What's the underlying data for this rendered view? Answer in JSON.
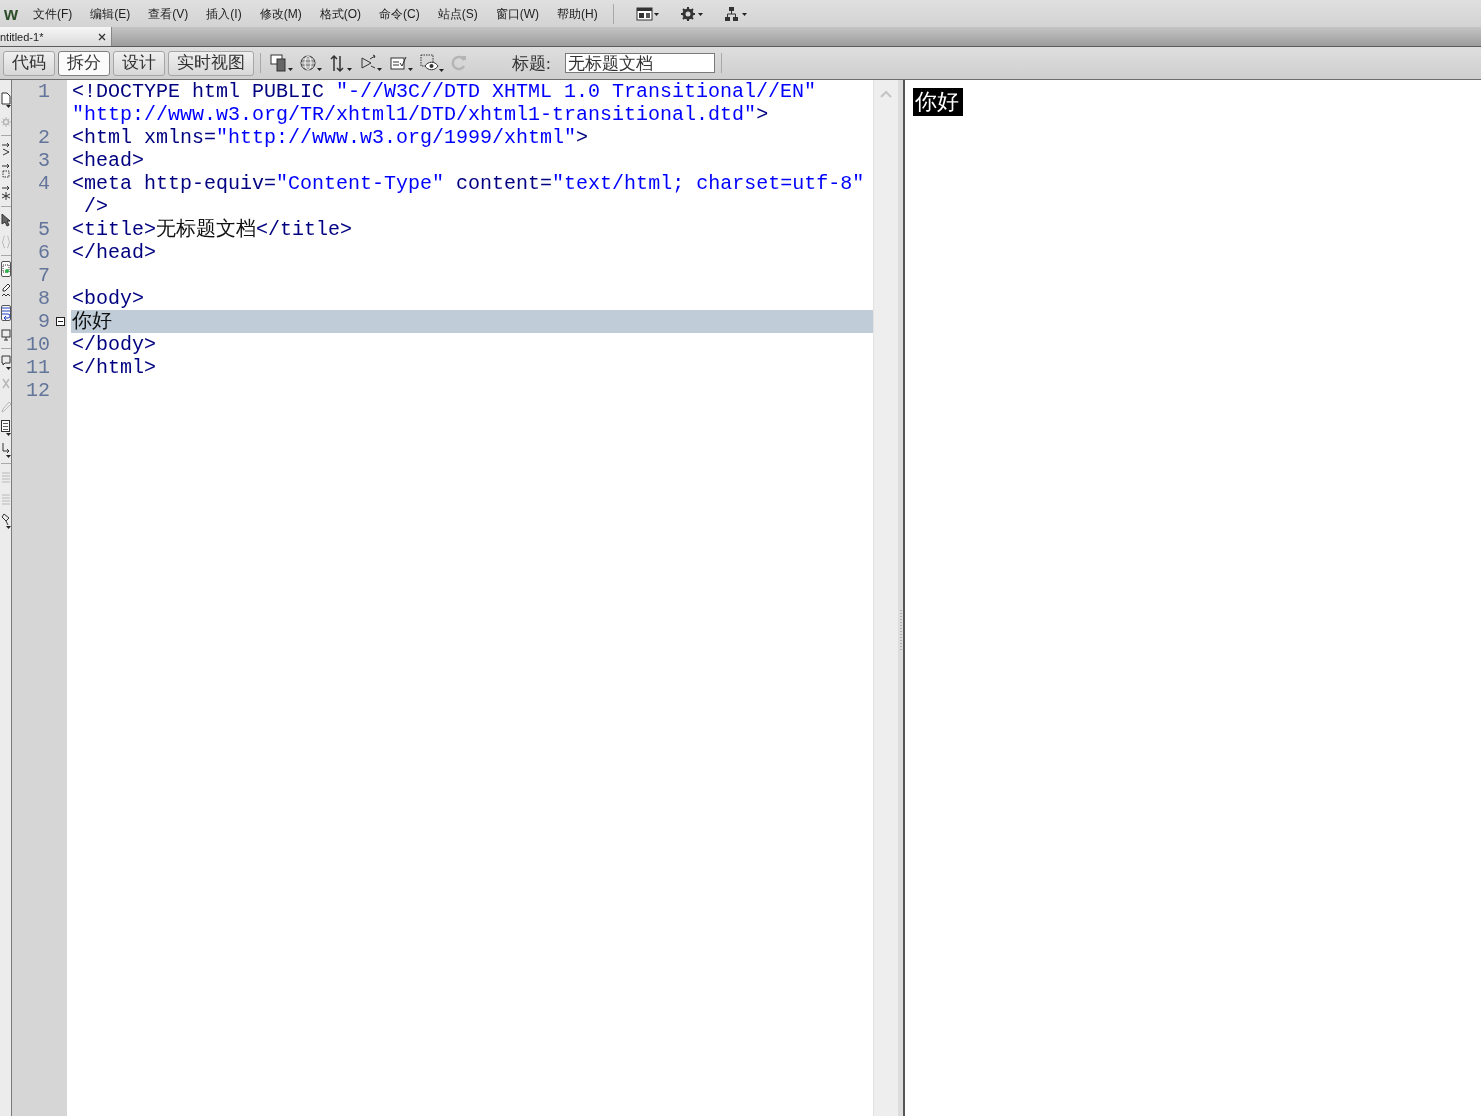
{
  "menu_bar": {
    "logo": "w",
    "items": [
      "文件(F)",
      "编辑(E)",
      "查看(V)",
      "插入(I)",
      "修改(M)",
      "格式(O)",
      "命令(C)",
      "站点(S)",
      "窗口(W)",
      "帮助(H)"
    ]
  },
  "document_tabs": [
    {
      "label": "ntitled-1*",
      "selected": true
    }
  ],
  "view_modes": [
    {
      "label": "代码",
      "selected": false
    },
    {
      "label": "拆分",
      "selected": true
    },
    {
      "label": "设计",
      "selected": false
    },
    {
      "label": "实时视图",
      "selected": false
    }
  ],
  "view_tools": [
    {
      "disabled": false
    },
    {
      "disabled": false
    },
    {
      "disabled": false
    },
    {
      "disabled": false
    },
    {
      "disabled": false
    },
    {
      "disabled": false
    },
    {
      "disabled": true
    }
  ],
  "title_field": {
    "label": "标题:",
    "value": "无标题文档"
  },
  "coding_toolbar": {
    "groups": [
      {
        "tools": [
          {
            "on": false,
            "disabled": false
          },
          {
            "on": false,
            "disabled": true
          }
        ]
      },
      {
        "tools": [
          {
            "on": false,
            "disabled": false
          },
          {
            "on": false,
            "disabled": false
          },
          {
            "on": false,
            "disabled": false
          }
        ]
      },
      {
        "tools": [
          {
            "on": false,
            "disabled": false
          },
          {
            "on": false,
            "disabled": true
          }
        ]
      },
      {
        "tools": [
          {
            "on": true,
            "disabled": false
          },
          {
            "on": false,
            "disabled": false
          },
          {
            "on": true,
            "disabled": false
          },
          {
            "on": false,
            "disabled": false
          }
        ]
      },
      {
        "tools": [
          {
            "on": false,
            "disabled": false
          },
          {
            "on": false,
            "disabled": true
          },
          {
            "on": false,
            "disabled": true
          },
          {
            "on": false,
            "disabled": false
          },
          {
            "on": false,
            "disabled": false
          }
        ]
      },
      {
        "tools": [
          {
            "on": false,
            "disabled": true
          },
          {
            "on": false,
            "disabled": true
          },
          {
            "on": false,
            "disabled": false
          }
        ]
      }
    ]
  },
  "code_editor": {
    "lines": [
      {
        "number": "1",
        "selected": false,
        "fold_marker": false,
        "rows": [
          [
            {
              "kind": "tag",
              "text": "<!DOCTYPE html PUBLIC "
            },
            {
              "kind": "string",
              "text": "\"-//W3C//DTD XHTML 1.0 Transitional//EN\""
            }
          ],
          [
            {
              "kind": "string",
              "text": "\"http://www.w3.org/TR/xhtml1/DTD/xhtml1-transitional.dtd\""
            },
            {
              "kind": "tag",
              "text": ">"
            }
          ]
        ]
      },
      {
        "number": "2",
        "selected": false,
        "fold_marker": false,
        "rows": [
          [
            {
              "kind": "tag",
              "text": "<html xmlns="
            },
            {
              "kind": "string",
              "text": "\"http://www.w3.org/1999/xhtml\""
            },
            {
              "kind": "tag",
              "text": ">"
            }
          ]
        ]
      },
      {
        "number": "3",
        "selected": false,
        "fold_marker": false,
        "rows": [
          [
            {
              "kind": "tag",
              "text": "<head>"
            }
          ]
        ]
      },
      {
        "number": "4",
        "selected": false,
        "fold_marker": false,
        "rows": [
          [
            {
              "kind": "tag",
              "text": "<meta http-equiv="
            },
            {
              "kind": "string",
              "text": "\"Content-Type\""
            },
            {
              "kind": "tag",
              "text": " content="
            },
            {
              "kind": "string",
              "text": "\"text/html; charset=utf-8\""
            }
          ],
          [
            {
              "kind": "tag",
              "text": " />"
            }
          ]
        ]
      },
      {
        "number": "5",
        "selected": false,
        "fold_marker": false,
        "rows": [
          [
            {
              "kind": "tag",
              "text": "<title>"
            },
            {
              "kind": "text",
              "text": "无标题文档"
            },
            {
              "kind": "tag",
              "text": "</title>"
            }
          ]
        ]
      },
      {
        "number": "6",
        "selected": false,
        "fold_marker": false,
        "rows": [
          [
            {
              "kind": "tag",
              "text": "</head>"
            }
          ]
        ]
      },
      {
        "number": "7",
        "selected": false,
        "fold_marker": false
      },
      {
        "number": "8",
        "selected": false,
        "fold_marker": false,
        "rows": [
          [
            {
              "kind": "tag",
              "text": "<body>"
            }
          ]
        ]
      },
      {
        "number": "9",
        "selected": true,
        "fold_marker": true,
        "rows": [
          [
            {
              "kind": "text",
              "text": "你好"
            }
          ]
        ]
      },
      {
        "number": "10",
        "selected": false,
        "fold_marker": false,
        "rows": [
          [
            {
              "kind": "tag",
              "text": "</body>"
            }
          ]
        ]
      },
      {
        "number": "11",
        "selected": false,
        "fold_marker": false,
        "rows": [
          [
            {
              "kind": "tag",
              "text": "</html>"
            }
          ]
        ]
      },
      {
        "number": "12",
        "selected": false,
        "fold_marker": false
      }
    ]
  },
  "live_preview": {
    "text": "你好"
  }
}
